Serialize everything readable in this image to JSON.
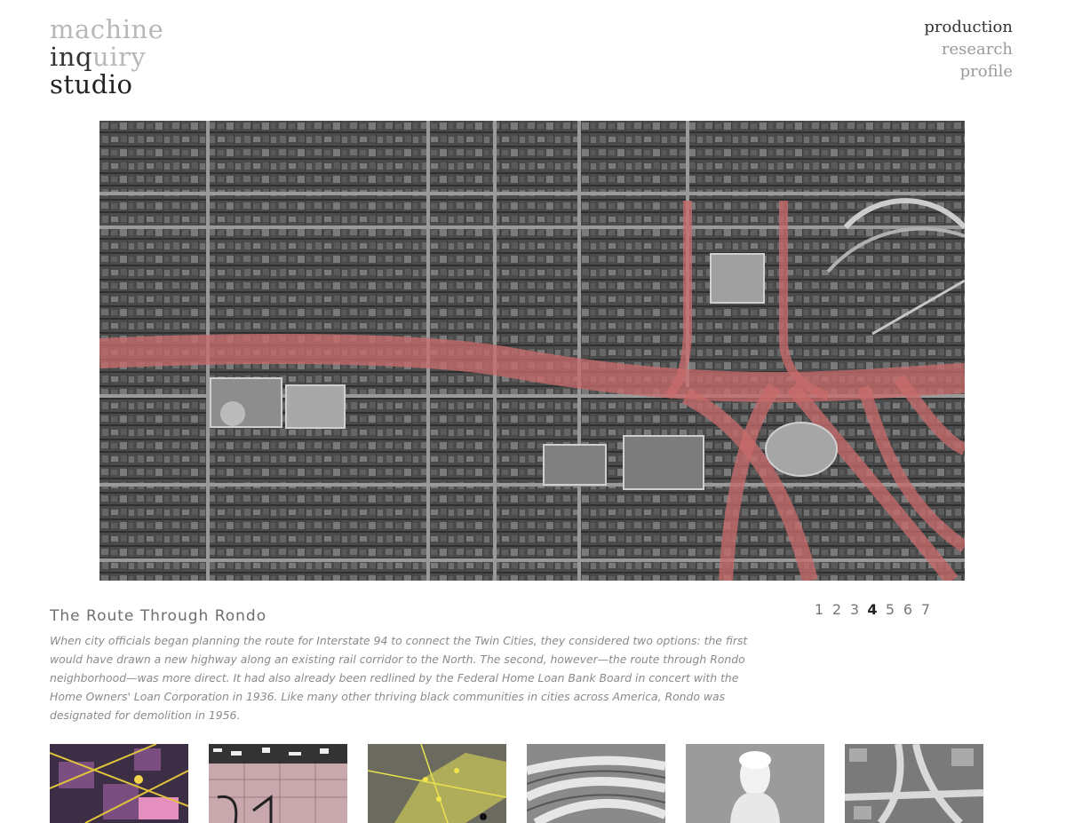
{
  "logo": {
    "line1": "machine",
    "line2a": "inq",
    "line2b": "uiry",
    "line3": "studio"
  },
  "nav": [
    {
      "label": "production",
      "active": true
    },
    {
      "label": "research",
      "active": false
    },
    {
      "label": "profile",
      "active": false
    }
  ],
  "project": {
    "title": "The Route Through Rondo",
    "description": "When city officials began planning the route for Interstate 94 to connect the Twin Cities, they considered two options: the first would have drawn a new highway along an existing rail corridor to the North. The second, however—the route through Rondo neighborhood—was more direct. It had also already been redlined by the Federal Home Loan Bank Board in concert with the Home Owners' Loan Corporation in 1936. Like many other thriving black communities in cities across America, Rondo was designated for demolition in 1956."
  },
  "pager": {
    "pages": [
      "1",
      "2",
      "3",
      "4",
      "5",
      "6",
      "7"
    ],
    "current": "4"
  },
  "colors": {
    "highway_overlay": "#c86a6a",
    "map_base": "#3a3a3a",
    "text_light": "#8a8a8a",
    "text_dark": "#333333"
  }
}
